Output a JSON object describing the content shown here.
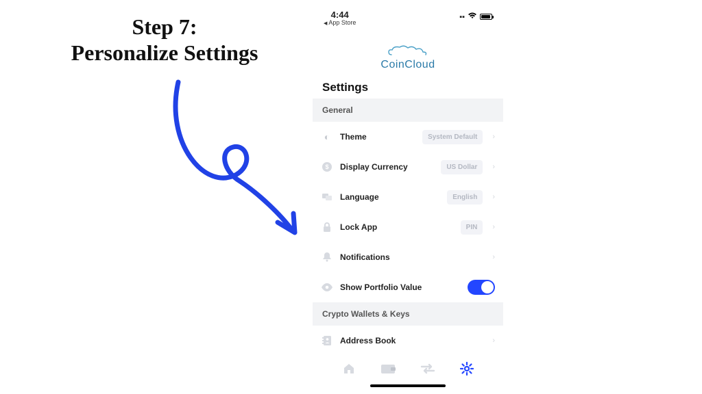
{
  "heading": {
    "line1": "Step 7:",
    "line2": "Personalize Settings"
  },
  "status": {
    "time": "4:44",
    "back_to": "App Store"
  },
  "brand": "CoinCloud",
  "page_title": "Settings",
  "sections": {
    "general": {
      "header": "General",
      "rows": {
        "theme": {
          "label": "Theme",
          "value": "System Default"
        },
        "currency": {
          "label": "Display Currency",
          "value": "US Dollar"
        },
        "language": {
          "label": "Language",
          "value": "English"
        },
        "lock": {
          "label": "Lock App",
          "value": "PIN"
        },
        "notifications": {
          "label": "Notifications"
        },
        "portfolio": {
          "label": "Show Portfolio Value",
          "toggle": true
        }
      }
    },
    "wallets": {
      "header": "Crypto Wallets & Keys",
      "rows": {
        "address_book": {
          "label": "Address Book"
        }
      }
    }
  },
  "colors": {
    "accent": "#2346ff",
    "brand": "#2a7aa8",
    "muted": "#c7cbd1",
    "section_bg": "#f2f3f5"
  }
}
